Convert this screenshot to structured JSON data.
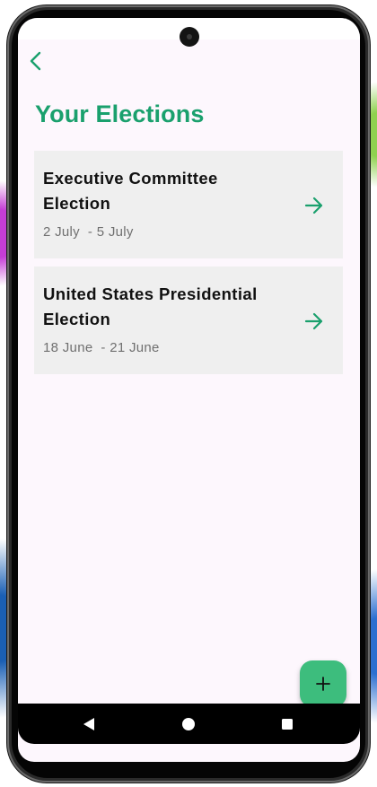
{
  "app": {
    "title": "Your Elections"
  },
  "header": {
    "back_icon": "chevron-left-icon"
  },
  "elections": [
    {
      "title": "Executive Committee Election",
      "start": "2 July",
      "end": "5 July",
      "arrow_icon": "arrow-right-icon"
    },
    {
      "title": "United States Presidential Election",
      "start": "18 June",
      "end": "21 June",
      "arrow_icon": "arrow-right-icon"
    }
  ],
  "fab": {
    "icon": "plus-icon"
  },
  "system_nav": {
    "back_icon": "triangle-back-icon",
    "home_icon": "circle-home-icon",
    "recents_icon": "square-recents-icon"
  },
  "colors": {
    "accent": "#1aa06d",
    "fab": "#3dbd7d",
    "card_bg": "#efefef",
    "screen_bg": "#fdf7fd"
  }
}
